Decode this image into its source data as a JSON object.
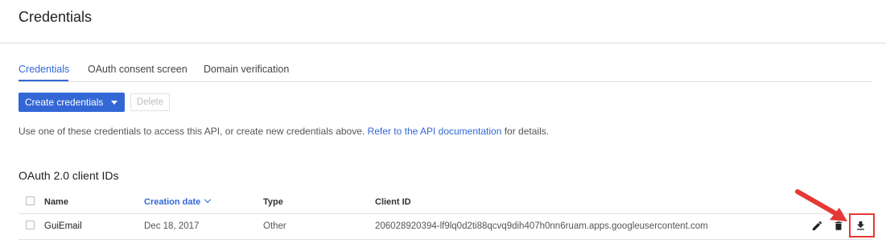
{
  "page": {
    "title": "Credentials"
  },
  "tabs": [
    {
      "label": "Credentials",
      "active": true
    },
    {
      "label": "OAuth consent screen",
      "active": false
    },
    {
      "label": "Domain verification",
      "active": false
    }
  ],
  "toolbar": {
    "create_label": "Create credentials",
    "delete_label": "Delete"
  },
  "info": {
    "text": "Use one of these credentials to access this API, or create new credentials above.",
    "link_text": "Refer to the API documentation",
    "suffix": "for details."
  },
  "section": {
    "title": "OAuth 2.0 client IDs"
  },
  "table": {
    "columns": {
      "name": "Name",
      "creation_date": "Creation date",
      "type": "Type",
      "client_id": "Client ID"
    },
    "rows": [
      {
        "name": "GuiEmail",
        "creation_date": "Dec 18, 2017",
        "type": "Other",
        "client_id": "206028920394-lf9lq0d2ti88qcvq9dih407h0nn6ruam.apps.googleusercontent.com"
      }
    ]
  },
  "colors": {
    "accent": "#3367d6",
    "highlight": "#e53935"
  },
  "icons": [
    "edit-icon",
    "delete-icon",
    "download-icon",
    "arrow-annotation"
  ]
}
